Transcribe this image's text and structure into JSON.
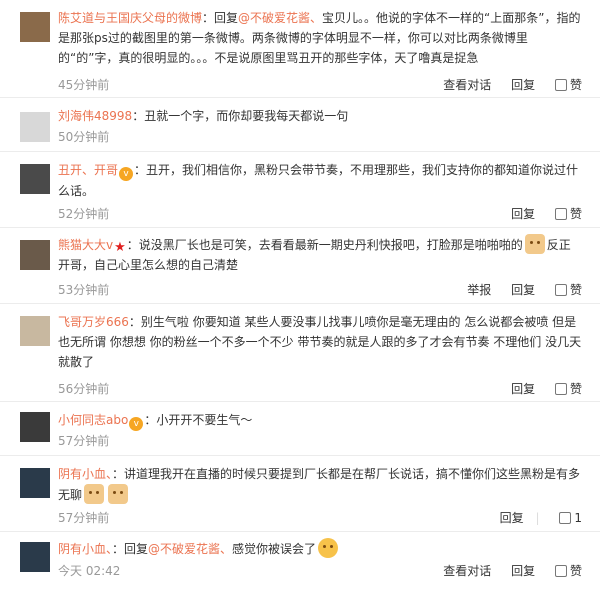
{
  "comments": [
    {
      "author": "陈艾道与王国庆父母的微博",
      "avatar_color": "#8a6a4a",
      "prefix": "：回复",
      "mention": "@不破爱花酱、",
      "text": "宝贝儿。。他说的字体不一样的“上面那条”，指的是那张ps过的截图里的第一条微博。两条微博的字体明显不一样，你可以对比两条微博里的“的”字，真的很明显的。。。不是说原图里骂丑开的那些字体，天了噜真是捉急",
      "time": "45分钟前",
      "actions": [
        "查看对话",
        "回复",
        "赞"
      ]
    },
    {
      "author": "刘海伟48998",
      "avatar_color": "#d8d8d8",
      "text": "：丑就一个字，而你却要我每天都说一句",
      "time": "50分钟前",
      "actions": [
        "回复",
        "赞"
      ]
    },
    {
      "author": "丑开、开哥",
      "avatar_color": "#4a4a4a",
      "text": "：丑开，我们相信你，黑粉只会带节奏，不用理那些，我们支持你的都知道你说过什么话。",
      "time": "52分钟前",
      "actions": [
        "回复",
        "赞"
      ]
    },
    {
      "author": "熊猫大大v",
      "avatar_color": "#6a5a4a",
      "text": "：说没黑厂长也是可笑，去看看最新一期史丹利快报吧，打脸那是啪啪啪的",
      "text2": "反正开哥，自己心里怎么想的自己清楚",
      "time": "53分钟前",
      "actions": [
        "举报",
        "回复",
        "赞"
      ]
    },
    {
      "author": "飞哥万岁666",
      "avatar_color": "#c8b8a0",
      "text": "：别生气啦 你要知道 某些人要没事儿找事儿喷你是毫无理由的 怎么说都会被喷 但是也无所谓 你想想 你的粉丝一个不多一个不少 带节奏的就是人跟的多了才会有节奏 不理他们 没几天就散了",
      "time": "56分钟前",
      "actions": [
        "回复",
        "赞"
      ]
    },
    {
      "author": "小何同志abo",
      "avatar_color": "#3a3a3a",
      "text": "：小开开不要生气～",
      "time": "57分钟前",
      "actions": [
        "回复",
        "赞"
      ]
    },
    {
      "author": "阴有小血、",
      "avatar_color": "#2a3a4a",
      "text": "：讲道理我开在直播的时候只要提到厂长都是在帮厂长说话，搞不懂你们这些黑粉是有多无聊",
      "time": "57分钟前",
      "actions": [
        "回复",
        "1"
      ]
    },
    {
      "author": "阴有小血、",
      "avatar_color": "#2a3a4a",
      "prefix": "：回复",
      "mention": "@不破爱花酱、",
      "text": "感觉你被误会了",
      "time": "今天 02:42",
      "actions": [
        "查看对话",
        "回复",
        "赞"
      ]
    }
  ],
  "colors": {
    "name": "#eb7350",
    "time": "#999999",
    "text": "#333333"
  }
}
